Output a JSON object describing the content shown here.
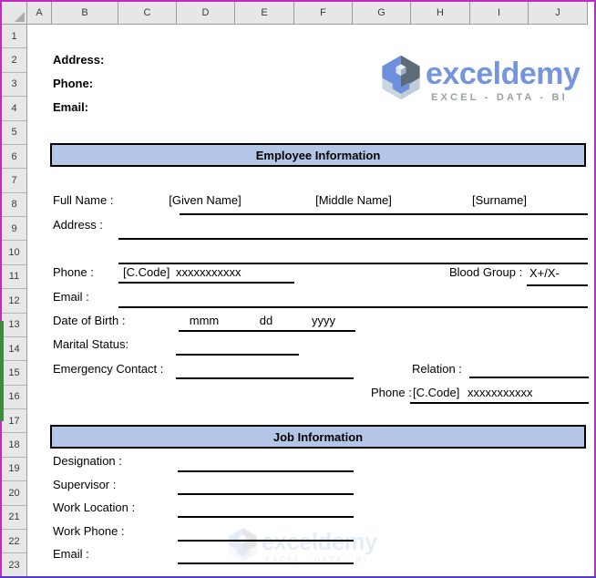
{
  "grid": {
    "corner_label": "",
    "columns": [
      "A",
      "B",
      "C",
      "D",
      "E",
      "F",
      "G",
      "H",
      "I",
      "J"
    ],
    "rows": [
      "1",
      "2",
      "3",
      "4",
      "5",
      "6",
      "7",
      "8",
      "9",
      "10",
      "11",
      "12",
      "13",
      "14",
      "15",
      "16",
      "17",
      "18",
      "19",
      "20",
      "21",
      "22",
      "23"
    ]
  },
  "letterhead": {
    "address_label": "Address:",
    "phone_label": "Phone:",
    "email_label": "Email:"
  },
  "logo": {
    "brand": "exceldemy",
    "tagline": "EXCEL - DATA - BI"
  },
  "employee_section": {
    "title": "Employee Information",
    "full_name_label": "Full Name :",
    "given_name_placeholder": "[Given Name]",
    "middle_name_placeholder": "[Middle Name]",
    "surname_placeholder": "[Surname]",
    "address_label": "Address :",
    "phone_label": "Phone :",
    "phone_country_code_placeholder": "[C.Code]",
    "phone_number_placeholder": "xxxxxxxxxxx",
    "blood_group_label": "Blood Group :",
    "blood_group_placeholder": "X+/X-",
    "email_label": "Email :",
    "dob_label": "Date of Birth :",
    "dob_month_placeholder": "mmm",
    "dob_day_placeholder": "dd",
    "dob_year_placeholder": "yyyy",
    "marital_status_label": "Marital Status:",
    "emergency_contact_label": "Emergency Contact :",
    "relation_label": "Relation :",
    "emergency_phone_label": "Phone :",
    "emergency_phone_country_code_placeholder": "[C.Code]",
    "emergency_phone_number_placeholder": "xxxxxxxxxxx"
  },
  "job_section": {
    "title": "Job Information",
    "designation_label": "Designation :",
    "supervisor_label": "Supervisor :",
    "work_location_label": "Work Location :",
    "work_phone_label": "Work Phone :",
    "email_label": "Email :"
  },
  "colors": {
    "section_header_bg": "#B4C6E7",
    "logo_blue": "#7595DE",
    "logo_slate": "#5E6B78",
    "logo_light": "#CBD7DF",
    "tagline_gray": "#999FA8",
    "frame_magenta": "#C22BC2",
    "frame_violet": "#5939C9",
    "frame_green": "#3F8A3F",
    "excel_header_bg": "#E7E7E7"
  }
}
